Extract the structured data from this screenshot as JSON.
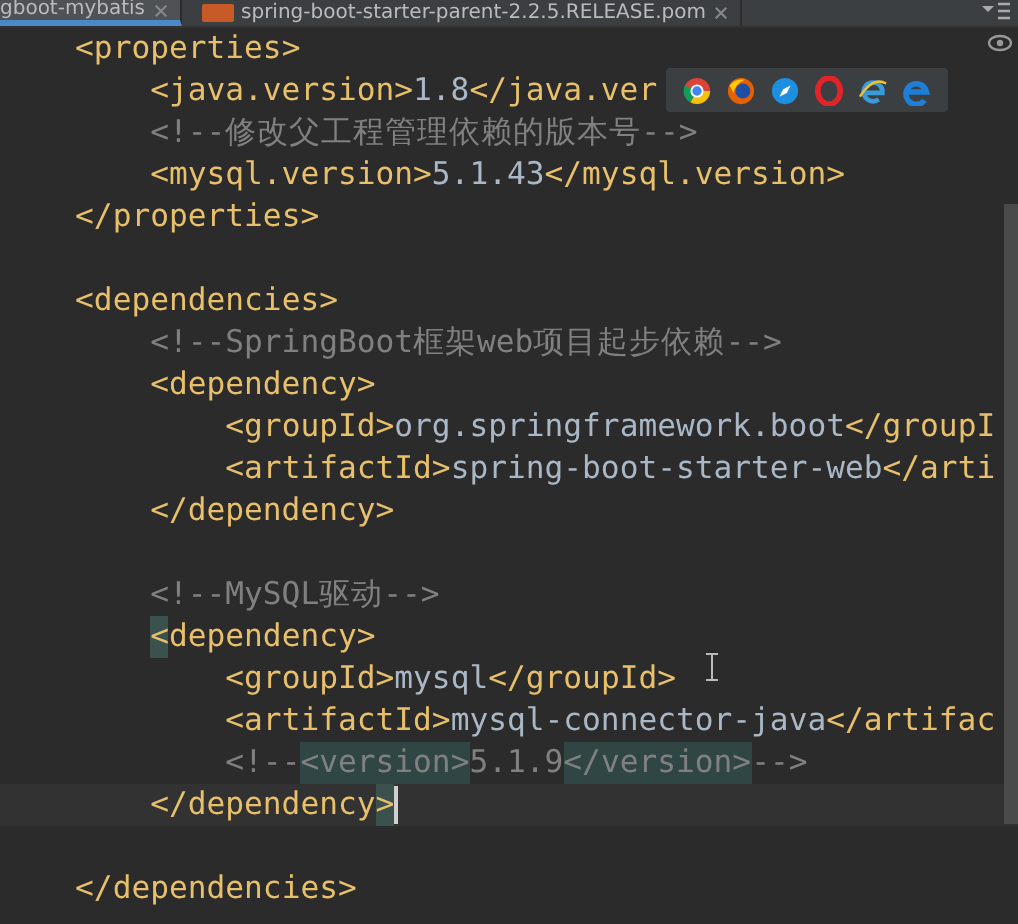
{
  "tabs": [
    {
      "label": "gboot-mybatis",
      "selected": true
    },
    {
      "label": "spring-boot-starter-parent-2.2.5.RELEASE.pom",
      "selected": false
    }
  ],
  "editor": {
    "nodes": [
      {
        "kind": "element",
        "open": {
          "tokens": [
            {
              "kind": "tag",
              "text": "<properties>"
            }
          ]
        },
        "children": [
          {
            "kind": "line",
            "tokens": [
              {
                "kind": "tag",
                "text": "<java.version>"
              },
              {
                "kind": "value",
                "text": "1.8"
              },
              {
                "kind": "tag",
                "text": "</java.ver"
              }
            ]
          },
          {
            "kind": "line",
            "tokens": [
              {
                "kind": "comment",
                "text": "<!--修改父工程管理依赖的版本号-->"
              }
            ]
          },
          {
            "kind": "line",
            "tokens": [
              {
                "kind": "tag",
                "text": "<mysql.version>"
              },
              {
                "kind": "value",
                "text": "5.1.43"
              },
              {
                "kind": "tag",
                "text": "</mysql.version>"
              }
            ]
          }
        ],
        "close": {
          "tokens": [
            {
              "kind": "tag",
              "text": "</properties>"
            }
          ],
          "current": false
        }
      },
      {
        "kind": "blank"
      },
      {
        "kind": "element",
        "open": {
          "tokens": [
            {
              "kind": "tag",
              "text": "<dependencies>"
            }
          ]
        },
        "children": [
          {
            "kind": "line",
            "tokens": [
              {
                "kind": "comment",
                "text": "<!--SpringBoot框架web项目起步依赖-->"
              }
            ]
          },
          {
            "kind": "element",
            "open": {
              "tokens": [
                {
                  "kind": "tag",
                  "text": "<dependency>"
                }
              ]
            },
            "children": [
              {
                "kind": "line",
                "tokens": [
                  {
                    "kind": "tag",
                    "text": "<groupId>"
                  },
                  {
                    "kind": "value",
                    "text": "org.springframework.boot"
                  },
                  {
                    "kind": "tag",
                    "text": "</groupI"
                  }
                ]
              },
              {
                "kind": "line",
                "tokens": [
                  {
                    "kind": "tag",
                    "text": "<artifactId>"
                  },
                  {
                    "kind": "value",
                    "text": "spring-boot-starter-web"
                  },
                  {
                    "kind": "tag",
                    "text": "</arti"
                  }
                ]
              }
            ],
            "close": {
              "tokens": [
                {
                  "kind": "tag",
                  "text": "</dependency>"
                }
              ],
              "current": false
            }
          },
          {
            "kind": "blank"
          },
          {
            "kind": "line",
            "tokens": [
              {
                "kind": "comment",
                "text": "<!--MySQL驱动-->"
              }
            ]
          },
          {
            "kind": "element",
            "open": {
              "tokens": [
                {
                  "kind": "bracket_match",
                  "text": "<"
                },
                {
                  "kind": "tag",
                  "text": "dependency>"
                }
              ]
            },
            "children": [
              {
                "kind": "line",
                "tokens": [
                  {
                    "kind": "tag",
                    "text": "<groupId>"
                  },
                  {
                    "kind": "value",
                    "text": "mysql"
                  },
                  {
                    "kind": "tag",
                    "text": "</groupId>"
                  }
                ]
              },
              {
                "kind": "line",
                "tokens": [
                  {
                    "kind": "tag",
                    "text": "<artifactId>"
                  },
                  {
                    "kind": "value",
                    "text": "mysql-connector-java"
                  },
                  {
                    "kind": "tag",
                    "text": "</artifac"
                  }
                ]
              },
              {
                "kind": "line",
                "tokens": [
                  {
                    "kind": "comment",
                    "text": "<!--"
                  },
                  {
                    "kind": "comment_tag",
                    "text": "<version>"
                  },
                  {
                    "kind": "comment",
                    "text": "5.1.9"
                  },
                  {
                    "kind": "comment_tag",
                    "text": "</version>"
                  },
                  {
                    "kind": "comment",
                    "text": "-->"
                  }
                ]
              }
            ],
            "close": {
              "tokens": [
                {
                  "kind": "tag",
                  "text": "</dependency"
                },
                {
                  "kind": "bracket_match",
                  "text": ">"
                }
              ],
              "current": true
            }
          },
          {
            "kind": "blank"
          }
        ],
        "close": {
          "tokens": [
            {
              "kind": "tag",
              "text": "</dependencies>"
            }
          ],
          "current": false
        }
      }
    ]
  }
}
